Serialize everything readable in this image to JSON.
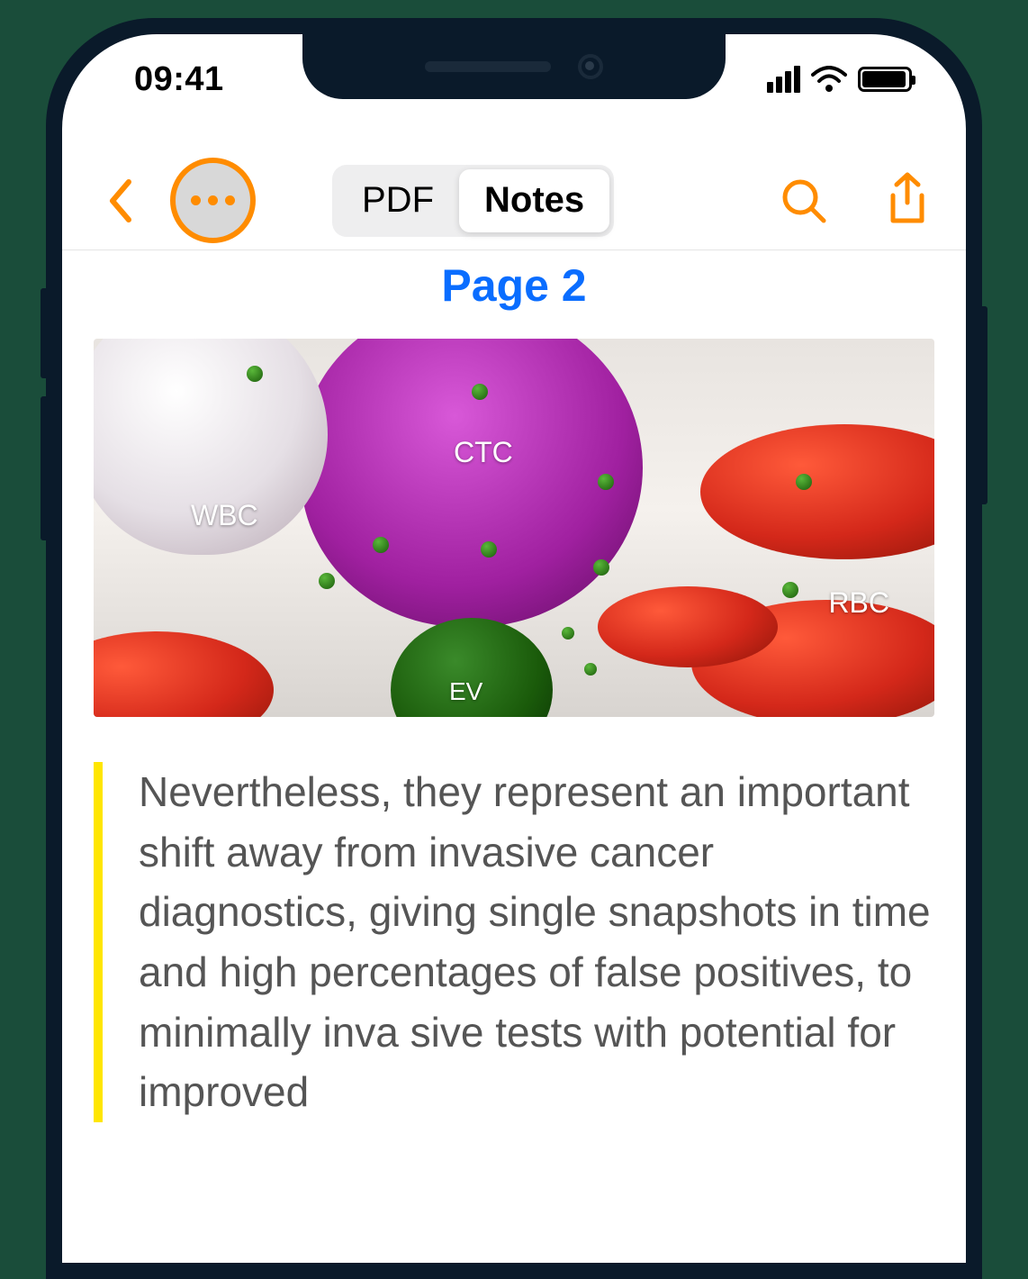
{
  "status": {
    "time": "09:41"
  },
  "toolbar": {
    "tabs": {
      "pdf": "PDF",
      "notes": "Notes",
      "active": "notes"
    }
  },
  "content": {
    "page_label": "Page 2",
    "hero": {
      "labels": {
        "wbc": "WBC",
        "ctc": "CTC",
        "rbc": "RBC",
        "ev": "EV"
      }
    },
    "note": "Nevertheless, they represent an important shift away from invasive cancer diagnostics, giving single snapshots in time and high percentages of false positives, to minimally inva sive tests with potential for improved"
  },
  "colors": {
    "accent": "#ff8c00",
    "link": "#0a6dff",
    "highlight": "#ffe600"
  }
}
